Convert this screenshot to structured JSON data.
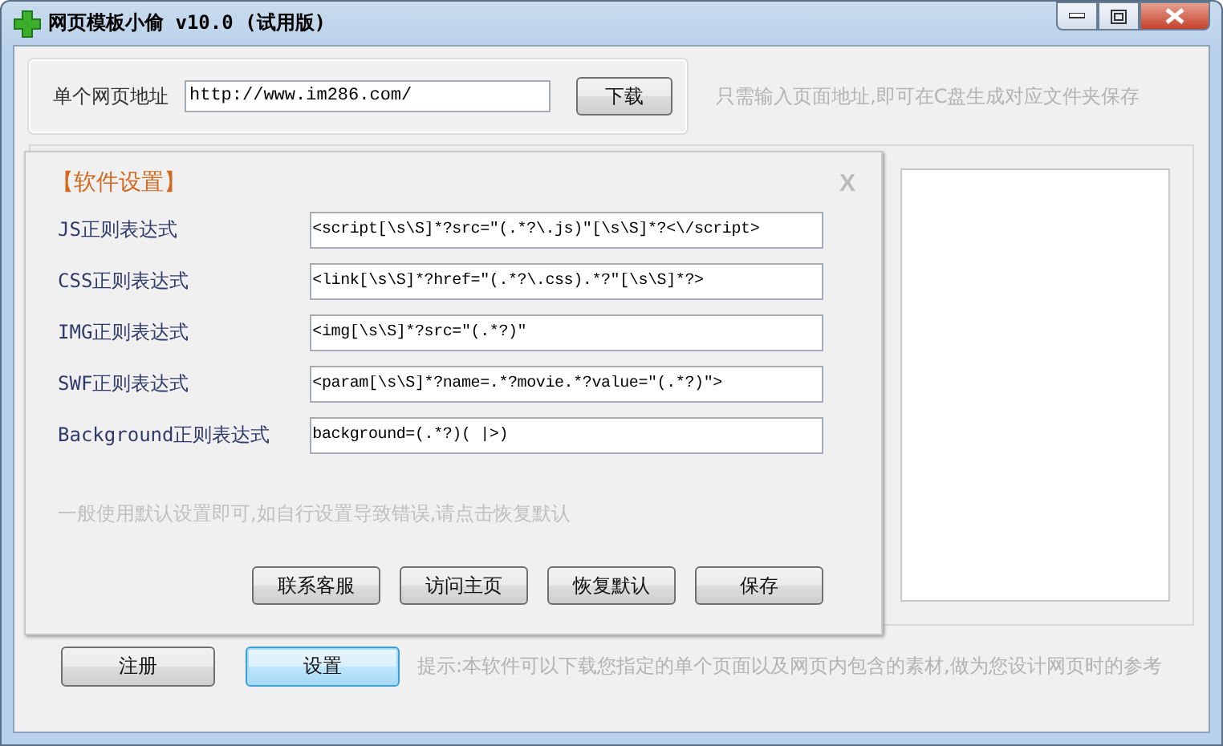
{
  "window": {
    "title": "网页模板小偷 v10.0 (试用版)"
  },
  "url_group": {
    "label": "单个网页地址",
    "value": "http://www.im286.com/",
    "button": "下载",
    "hint": "只需输入页面地址,即可在C盘生成对应文件夹保存"
  },
  "settings_dialog": {
    "title": "【软件设置】",
    "close": "X",
    "rules": [
      {
        "label": "JS正则表达式",
        "value": "<script[\\s\\S]*?src=\"(.*?\\.js)\"[\\s\\S]*?<\\/script>"
      },
      {
        "label": "CSS正则表达式",
        "value": "<link[\\s\\S]*?href=\"(.*?\\.css).*?\"[\\s\\S]*?>"
      },
      {
        "label": "IMG正则表达式",
        "value": "<img[\\s\\S]*?src=\"(.*?)\""
      },
      {
        "label": "SWF正则表达式",
        "value": "<param[\\s\\S]*?name=.*?movie.*?value=\"(.*?)\">"
      },
      {
        "label": "Background正则表达式",
        "value": "background=(.*?)( |>)"
      }
    ],
    "note": "一般使用默认设置即可,如自行设置导致错误,请点击恢复默认",
    "buttons": [
      "联系客服",
      "访问主页",
      "恢复默认",
      "保存"
    ]
  },
  "bottom_buttons": [
    {
      "label": "注册",
      "focused": false
    },
    {
      "label": "设置",
      "focused": true
    }
  ],
  "bottom_hint": "提示:本软件可以下载您指定的单个页面以及网页内包含的素材,做为您设计网页时的参考"
}
